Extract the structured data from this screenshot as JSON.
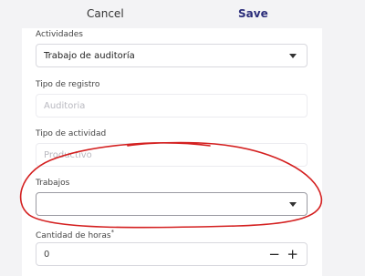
{
  "header": {
    "cancel_label": "Cancel",
    "save_label": "Save"
  },
  "form": {
    "actividades": {
      "label": "Actividades",
      "value": "Trabajo de auditoría"
    },
    "tipo_registro": {
      "label": "Tipo de registro",
      "placeholder": "Auditoria"
    },
    "tipo_actividad": {
      "label": "Tipo de actividad",
      "placeholder": "Productivo"
    },
    "trabajos": {
      "label": "Trabajos",
      "value": ""
    },
    "cantidad_horas": {
      "label": "Cantidad de horas",
      "required_mark": "*",
      "value": "0"
    }
  },
  "icons": {
    "dropdown": "chevron-down-icon",
    "minus": "minus-icon",
    "plus": "plus-icon"
  },
  "colors": {
    "accent": "#2b2d7a",
    "annotation": "#d42020"
  }
}
